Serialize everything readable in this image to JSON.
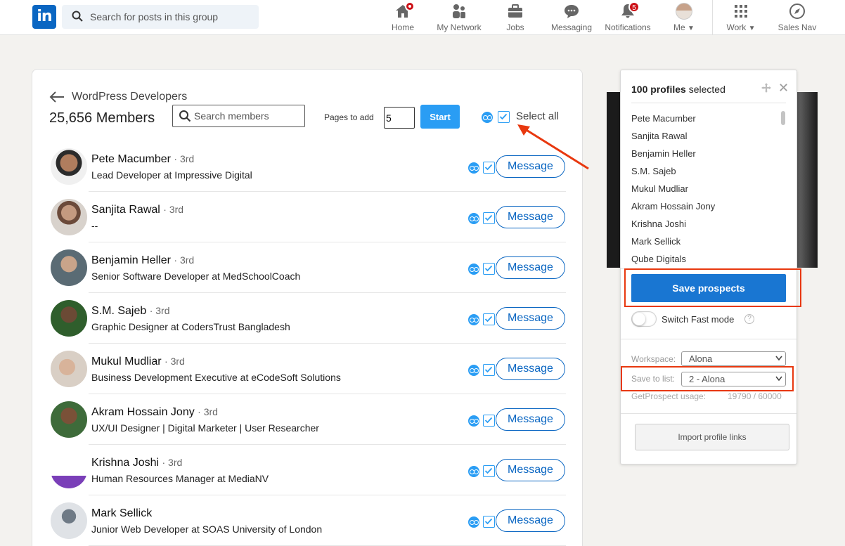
{
  "nav": {
    "logo_text": "in",
    "search_placeholder": "Search for posts in this group",
    "items": [
      {
        "label": "Home",
        "icon": "home-icon"
      },
      {
        "label": "My Network",
        "icon": "network-icon"
      },
      {
        "label": "Jobs",
        "icon": "jobs-icon"
      },
      {
        "label": "Messaging",
        "icon": "messaging-icon"
      },
      {
        "label": "Notifications",
        "icon": "bell-icon",
        "badge": "5"
      },
      {
        "label": "Me",
        "icon": "profile-photo"
      },
      {
        "label": "Work",
        "icon": "grid-icon"
      },
      {
        "label": "Sales Nav",
        "icon": "compass-icon"
      }
    ]
  },
  "group": {
    "title": "WordPress Developers",
    "members_count": "25,656 Members",
    "search_placeholder": "Search members",
    "pages_label": "Pages to add",
    "pages_value": "5",
    "start_label": "Start",
    "select_all_label": "Select all"
  },
  "members": [
    {
      "name": "Pete Macumber",
      "degree": "· 3rd",
      "title": "Lead Developer at Impressive Digital",
      "action": "Message"
    },
    {
      "name": "Sanjita Rawal",
      "degree": "· 3rd",
      "title": "--",
      "action": "Message"
    },
    {
      "name": "Benjamin Heller",
      "degree": "· 3rd",
      "title": "Senior Software Developer at MedSchoolCoach",
      "action": "Message"
    },
    {
      "name": "S.M. Sajeb",
      "degree": "· 3rd",
      "title": "Graphic Designer at CodersTrust Bangladesh",
      "action": "Message"
    },
    {
      "name": "Mukul Mudliar",
      "degree": "· 3rd",
      "title": "Business Development Executive at eCodeSoft Solutions",
      "action": "Message"
    },
    {
      "name": "Akram Hossain Jony",
      "degree": "· 3rd",
      "title": "UX/UI Designer | Digital Marketer | User Researcher",
      "action": "Message"
    },
    {
      "name": "Krishna Joshi",
      "degree": "· 3rd",
      "title": "Human Resources Manager at MediaNV",
      "action": "Message"
    },
    {
      "name": "Mark Sellick",
      "degree": "",
      "title": "Junior Web Developer at SOAS University of London",
      "action": "Message"
    }
  ],
  "panel": {
    "count_bold": "100 profiles",
    "count_rest": "selected",
    "profiles": [
      "Pete Macumber",
      "Sanjita Rawal",
      "Benjamin Heller",
      "S.M. Sajeb",
      "Mukul Mudliar",
      "Akram Hossain Jony",
      "Krishna Joshi",
      "Mark Sellick",
      "Qube Digitals"
    ],
    "save_label": "Save prospects",
    "fast_mode_label": "Switch Fast mode",
    "fast_mode_on": false,
    "workspace_label": "Workspace:",
    "workspace_value": "Alona",
    "list_label": "Save to list:",
    "list_value": "2 - Alona",
    "usage_label": "GetProspect usage:",
    "usage_value": "19790 / 60000",
    "import_label": "Import profile links"
  },
  "colors": {
    "linkedin_blue": "#0a66c2",
    "extension_blue": "#2a9df4",
    "annotation_red": "#e8380f",
    "badge_red": "#cc1016"
  }
}
